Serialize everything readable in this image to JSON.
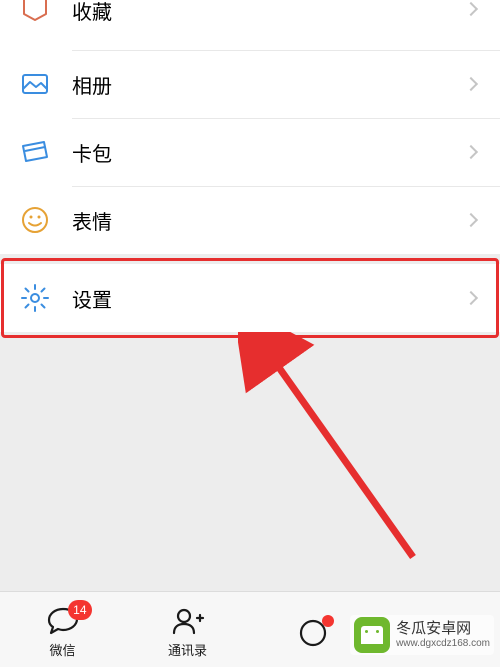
{
  "menu": {
    "favorite": {
      "label": "收藏"
    },
    "album": {
      "label": "相册"
    },
    "cards": {
      "label": "卡包"
    },
    "sticker": {
      "label": "表情"
    },
    "settings": {
      "label": "设置"
    }
  },
  "tabs": {
    "chat": {
      "label": "微信",
      "badge": "14"
    },
    "contacts": {
      "label": "通讯录"
    }
  },
  "watermark": {
    "title": "冬瓜安卓网",
    "url": "www.dgxcdz168.com"
  }
}
